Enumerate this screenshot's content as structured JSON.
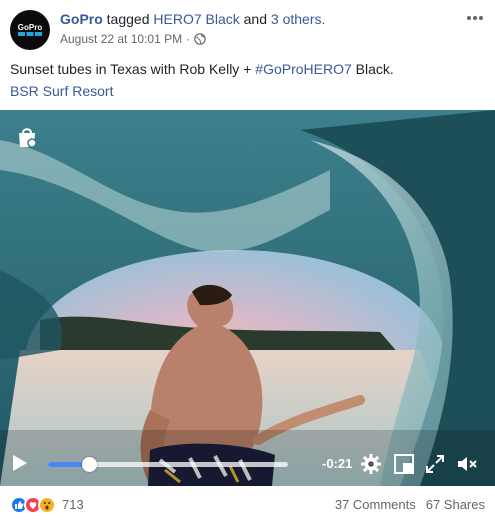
{
  "post": {
    "page_name": "GoPro",
    "tagged_word": "tagged",
    "tagged_page": "HERO7 Black",
    "and_word": "and",
    "others": "3 others.",
    "timestamp": "August 22 at 10:01 PM",
    "separator": "·",
    "text_before": "Sunset tubes in Texas with Rob Kelly + ",
    "hashtag": "#GoProHERO7",
    "text_after": " Black.",
    "location": "BSR Surf Resort",
    "more_icon": "more-horizontal-icon",
    "avatar_logo_text": "GoPro"
  },
  "video": {
    "time_remaining": "-0:21",
    "progress_fraction": 0.17,
    "icons": {
      "play": "play-icon",
      "settings": "settings-gear-icon",
      "pip": "picture-in-picture-icon",
      "fullscreen": "fullscreen-icon",
      "mute": "mute-icon",
      "shop": "shopping-bag-icon"
    }
  },
  "footer": {
    "reaction_count": "713",
    "comments": "37 Comments",
    "shares": "67 Shares",
    "reactions": [
      "like",
      "love",
      "wow"
    ]
  },
  "colors": {
    "link": "#385898",
    "meta": "#616770",
    "progress": "#4c86f5",
    "like": "#1877f2",
    "love": "#f33e58",
    "wow": "#f7b125"
  }
}
